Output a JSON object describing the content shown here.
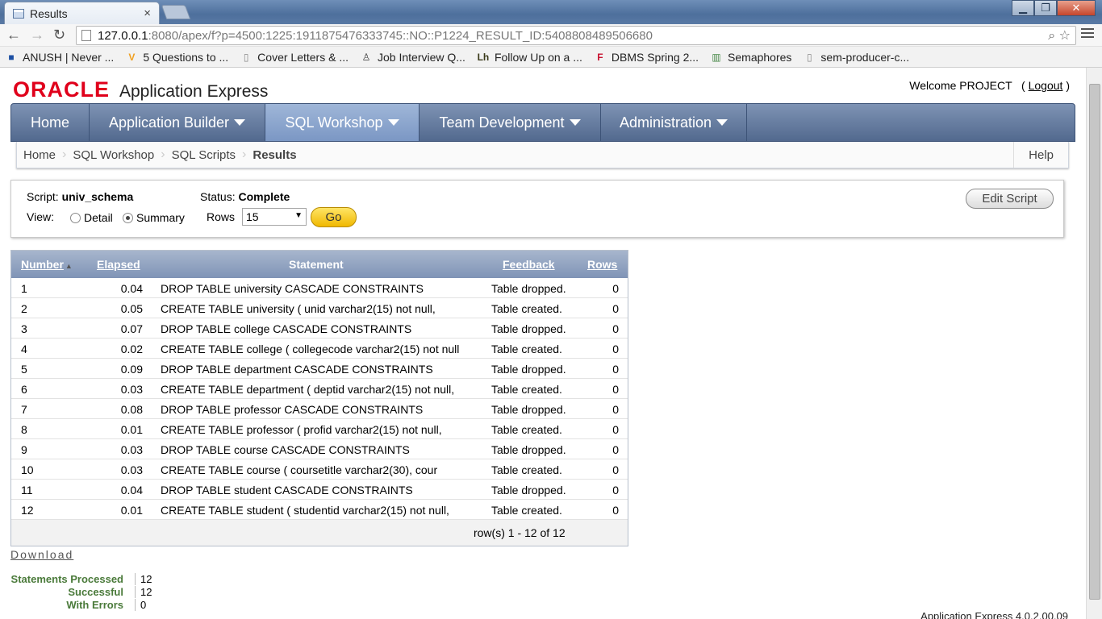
{
  "browser": {
    "tab_title": "Results",
    "tab_close": "×",
    "window_buttons": [
      "▁",
      "❐",
      "✕"
    ],
    "url_host": "127.0.0.1",
    "url_path": ":8080/apex/f?p=4500:1225:1911875476333745::NO::P1224_RESULT_ID:5408808489506680",
    "bookmarks": [
      {
        "label": "ANUSH | Never ...",
        "icon": "blue-square-icon",
        "color": "#1c4fa3"
      },
      {
        "label": "5 Questions to ...",
        "icon": "v-icon",
        "color": "#f0a020"
      },
      {
        "label": "Cover Letters & ...",
        "icon": "page-icon",
        "color": "#888888"
      },
      {
        "label": "Job Interview Q...",
        "icon": "person-icon",
        "color": "#333333"
      },
      {
        "label": "Follow Up on a ...",
        "icon": "lh-icon",
        "color": "#3a3a1a"
      },
      {
        "label": "DBMS Spring 2...",
        "icon": "f-icon",
        "color": "#c8102e"
      },
      {
        "label": "Semaphores",
        "icon": "chart-icon",
        "color": "#4a8a4a"
      },
      {
        "label": "sem-producer-c...",
        "icon": "page-icon",
        "color": "#888888"
      }
    ]
  },
  "header": {
    "logo_oracle": "ORACLE",
    "logo_product": "Application Express",
    "welcome": "Welcome PROJECT",
    "logout": "Logout"
  },
  "nav": {
    "tabs": [
      {
        "label": "Home",
        "dropdown": false
      },
      {
        "label": "Application Builder",
        "dropdown": true
      },
      {
        "label": "SQL Workshop",
        "dropdown": true,
        "active": true
      },
      {
        "label": "Team Development",
        "dropdown": true
      },
      {
        "label": "Administration",
        "dropdown": true
      }
    ]
  },
  "breadcrumb": {
    "items": [
      "Home",
      "SQL Workshop",
      "SQL Scripts",
      "Results"
    ],
    "help": "Help"
  },
  "filter": {
    "script_label": "Script:",
    "script_name": "univ_schema",
    "status_label": "Status:",
    "status_value": "Complete",
    "view_label": "View:",
    "detail": "Detail",
    "summary": "Summary",
    "rows_label": "Rows",
    "rows_value": "15",
    "go": "Go",
    "edit_script": "Edit Script"
  },
  "results": {
    "columns": [
      "Number",
      "Elapsed",
      "Statement",
      "Feedback",
      "Rows"
    ],
    "rows": [
      {
        "number": "1",
        "elapsed": "0.04",
        "statement": "DROP TABLE university CASCADE CONSTRAINTS",
        "feedback": "Table dropped.",
        "rows": "0"
      },
      {
        "number": "2",
        "elapsed": "0.05",
        "statement": "CREATE TABLE university ( unid varchar2(15) not null,",
        "feedback": "Table created.",
        "rows": "0"
      },
      {
        "number": "3",
        "elapsed": "0.07",
        "statement": "DROP TABLE college CASCADE CONSTRAINTS",
        "feedback": "Table dropped.",
        "rows": "0"
      },
      {
        "number": "4",
        "elapsed": "0.02",
        "statement": "CREATE TABLE college ( collegecode varchar2(15) not null",
        "feedback": "Table created.",
        "rows": "0"
      },
      {
        "number": "5",
        "elapsed": "0.09",
        "statement": "DROP TABLE department CASCADE CONSTRAINTS",
        "feedback": "Table dropped.",
        "rows": "0"
      },
      {
        "number": "6",
        "elapsed": "0.03",
        "statement": "CREATE TABLE department ( deptid varchar2(15) not null,",
        "feedback": "Table created.",
        "rows": "0"
      },
      {
        "number": "7",
        "elapsed": "0.08",
        "statement": "DROP TABLE professor CASCADE CONSTRAINTS",
        "feedback": "Table dropped.",
        "rows": "0"
      },
      {
        "number": "8",
        "elapsed": "0.01",
        "statement": "CREATE TABLE professor ( profid varchar2(15) not null,",
        "feedback": "Table created.",
        "rows": "0"
      },
      {
        "number": "9",
        "elapsed": "0.03",
        "statement": "DROP TABLE course CASCADE CONSTRAINTS",
        "feedback": "Table dropped.",
        "rows": "0"
      },
      {
        "number": "10",
        "elapsed": "0.03",
        "statement": "CREATE TABLE course ( coursetitle varchar2(30), cour",
        "feedback": "Table created.",
        "rows": "0"
      },
      {
        "number": "11",
        "elapsed": "0.04",
        "statement": "DROP TABLE student CASCADE CONSTRAINTS",
        "feedback": "Table dropped.",
        "rows": "0"
      },
      {
        "number": "12",
        "elapsed": "0.01",
        "statement": "CREATE TABLE student ( studentid varchar2(15) not null,",
        "feedback": "Table created.",
        "rows": "0"
      }
    ],
    "pager": "row(s) 1 - 12 of 12"
  },
  "download": "Download",
  "stats": [
    {
      "label": "Statements Processed",
      "value": "12"
    },
    {
      "label": "Successful",
      "value": "12"
    },
    {
      "label": "With Errors",
      "value": "0"
    }
  ],
  "footer": "Application Express 4.0.2.00.09"
}
